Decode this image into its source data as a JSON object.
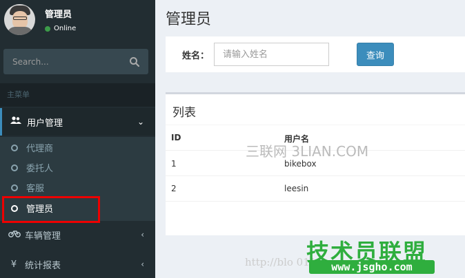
{
  "sidebar": {
    "user": {
      "name": "管理员",
      "status": "Online"
    },
    "search": {
      "placeholder": "Search..."
    },
    "menu_header": "主菜单",
    "items": [
      {
        "label": "用户管理",
        "icon": "users-icon",
        "arrow": "⌄"
      },
      {
        "label": "车辆管理",
        "icon": "bicycle-icon",
        "arrow": "‹"
      },
      {
        "label": "统计报表",
        "icon": "yen-icon",
        "arrow": "‹"
      }
    ],
    "subitems": [
      {
        "label": "代理商"
      },
      {
        "label": "委托人"
      },
      {
        "label": "客服"
      },
      {
        "label": "管理员"
      }
    ]
  },
  "main": {
    "title": "管理员",
    "search": {
      "label": "姓名：",
      "placeholder": "请输入姓名",
      "button": "查询"
    },
    "list": {
      "title": "列表",
      "columns": [
        "ID",
        "用户名"
      ],
      "rows": [
        {
          "id": "1",
          "username": "bikebox"
        },
        {
          "id": "2",
          "username": "leesin"
        }
      ]
    }
  },
  "watermarks": {
    "sanlian": "三联网 3LIAN.COM",
    "url": "http://blo                        011",
    "logo": "技术员联盟",
    "site": "www.jsgho.com"
  },
  "colors": {
    "sidebar_bg": "#222d32",
    "accent": "#3c8dbc",
    "highlight": "#ee0000",
    "online": "#3c9b49"
  }
}
